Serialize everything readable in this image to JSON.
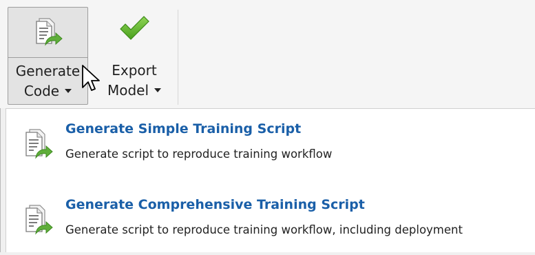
{
  "toolbar": {
    "generate_code": {
      "line1": "Generate",
      "line2": "Code",
      "icon": "generate-code-icon"
    },
    "export_model": {
      "line1": "Export",
      "line2": "Model",
      "icon": "checkmark-icon"
    }
  },
  "menu": {
    "items": [
      {
        "title": "Generate Simple Training Script",
        "description": "Generate script to reproduce training workflow",
        "icon": "script-icon"
      },
      {
        "title": "Generate Comprehensive Training Script",
        "description": "Generate script to reproduce training workflow, including deployment",
        "icon": "script-icon"
      }
    ]
  },
  "colors": {
    "title_blue": "#1a5fa8",
    "check_green": "#5fb82a",
    "arrow_green": "#5fae3a"
  }
}
